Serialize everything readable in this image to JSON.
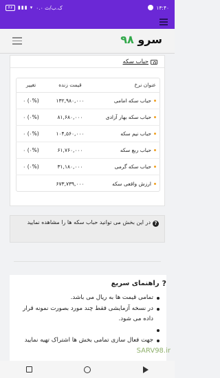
{
  "status_bar": {
    "time": "۱۳:۴۰",
    "network_speed": "۰.۰ ک.ب/ث",
    "battery": "۴۶"
  },
  "app": {
    "logo_word": "سرو",
    "logo_number": "۹۸"
  },
  "card": {
    "title": "حباب سکه",
    "headers": {
      "name": "عنوان نرخ",
      "price": "قیمت زنده",
      "change": "تغییر"
    },
    "rows": [
      {
        "name": "حباب سکه امامی",
        "price": "۱۳۲,۹۸۰,۰۰۰",
        "change": "۰ (۰%)"
      },
      {
        "name": "حباب سکه بهار آزادی",
        "price": "۸۱,۶۸۰,۰۰۰",
        "change": "۰ (۰%)"
      },
      {
        "name": "حباب نیم سکه",
        "price": "۱۰۴,۵۶۰,۰۰۰",
        "change": "۰ (۰%)"
      },
      {
        "name": "حباب ربع سکه",
        "price": "۶۱,۷۶۰,۰۰۰",
        "change": "۰ (۰%)"
      },
      {
        "name": "حباب سکه گرمی",
        "price": "۳۱,۱۸۰,۰۰۰",
        "change": "۰ (۰%)"
      },
      {
        "name": "ارزش واقعی سکه",
        "price": "۶۷۳,۷۳۹,۰۰۰",
        "change": ""
      }
    ]
  },
  "note": {
    "text": "در این بخش می توانید حباب سکه ها را مشاهده نمایید"
  },
  "guide": {
    "title": "راهنمای سریع",
    "items": [
      "تمامی قیمت ها به ریال می باشد.",
      "در نسخه آزمایشی فقط چند مورد بصورت نمونه قرار داده می شود.",
      "",
      "جهت فعال سازی تمامی بخش ها اشتراک تهیه نمایید"
    ]
  },
  "watermark": "SARV98.ir",
  "colors": {
    "purple": "#6b28d6",
    "logo_green": "#31a84a",
    "bullet_orange": "#f0a020"
  }
}
